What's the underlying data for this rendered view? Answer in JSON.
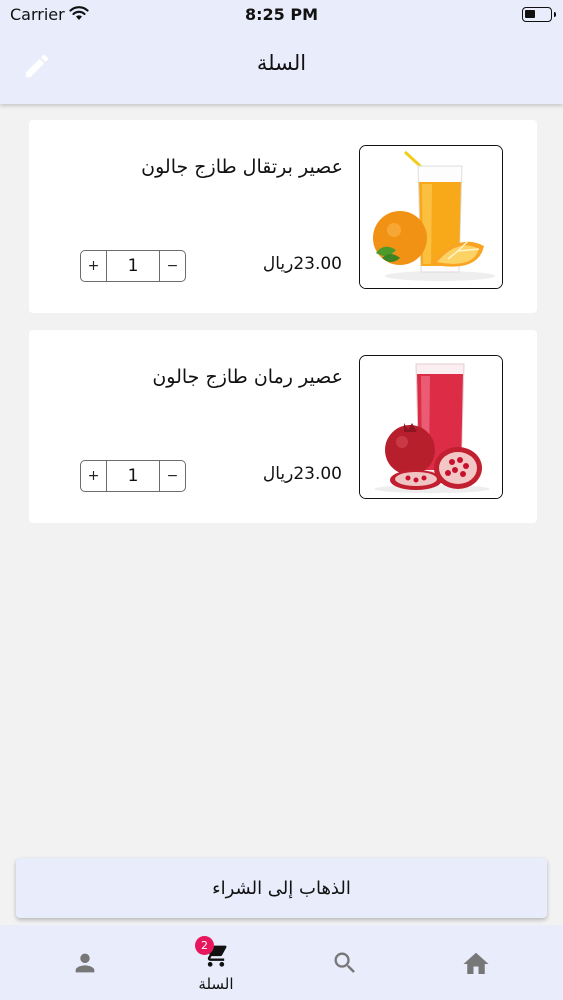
{
  "status_bar": {
    "carrier": "Carrier",
    "time": "8:25 PM"
  },
  "header": {
    "title": "السلة",
    "edit_icon": "pencil-icon"
  },
  "cart_items": [
    {
      "name": "عصير برتقال طازج جالون",
      "price": "23.00ريال",
      "quantity": "1",
      "image": "orange-juice"
    },
    {
      "name": "عصير رمان طازج جالون",
      "price": "23.00ريال",
      "quantity": "1",
      "image": "pomegranate-juice"
    }
  ],
  "stepper": {
    "plus": "+",
    "minus": "−"
  },
  "checkout": {
    "label": "الذهاب إلى الشراء"
  },
  "bottom_nav": {
    "items": [
      {
        "icon": "person-icon",
        "label": ""
      },
      {
        "icon": "cart-icon",
        "label": "السلة",
        "badge": "2"
      },
      {
        "icon": "search-icon",
        "label": ""
      },
      {
        "icon": "home-icon",
        "label": ""
      }
    ]
  },
  "colors": {
    "header_bg": "#e8ecfb",
    "badge": "#e8175d",
    "page_bg": "#f2f2f3"
  }
}
